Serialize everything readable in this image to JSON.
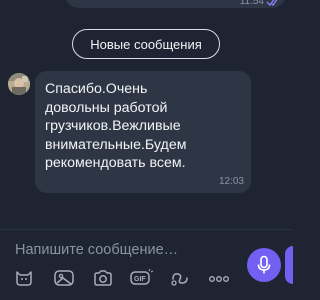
{
  "chat": {
    "outgoing_message": {
      "time": "11:54",
      "status_icon": "double-check-icon"
    },
    "new_messages_label": "Новые сообщения",
    "incoming_message": {
      "text": "Спасибо.Очень\nдовольны работой\nгрузчиков.Вежливые\nвнимательные.Будем\nрекомендовать всем.",
      "time": "12:03"
    }
  },
  "composer": {
    "placeholder": "Напишите сообщение…",
    "toolbar_icons": [
      "sticker-icon",
      "gallery-icon",
      "camera-icon",
      "gif-icon",
      "doodle-icon",
      "more-icon"
    ],
    "send_icon": "microphone-icon"
  },
  "colors": {
    "background": "#1e2431",
    "bubble": "#2e3646",
    "accent": "#7360f2",
    "muted_text": "#8b93a3"
  }
}
